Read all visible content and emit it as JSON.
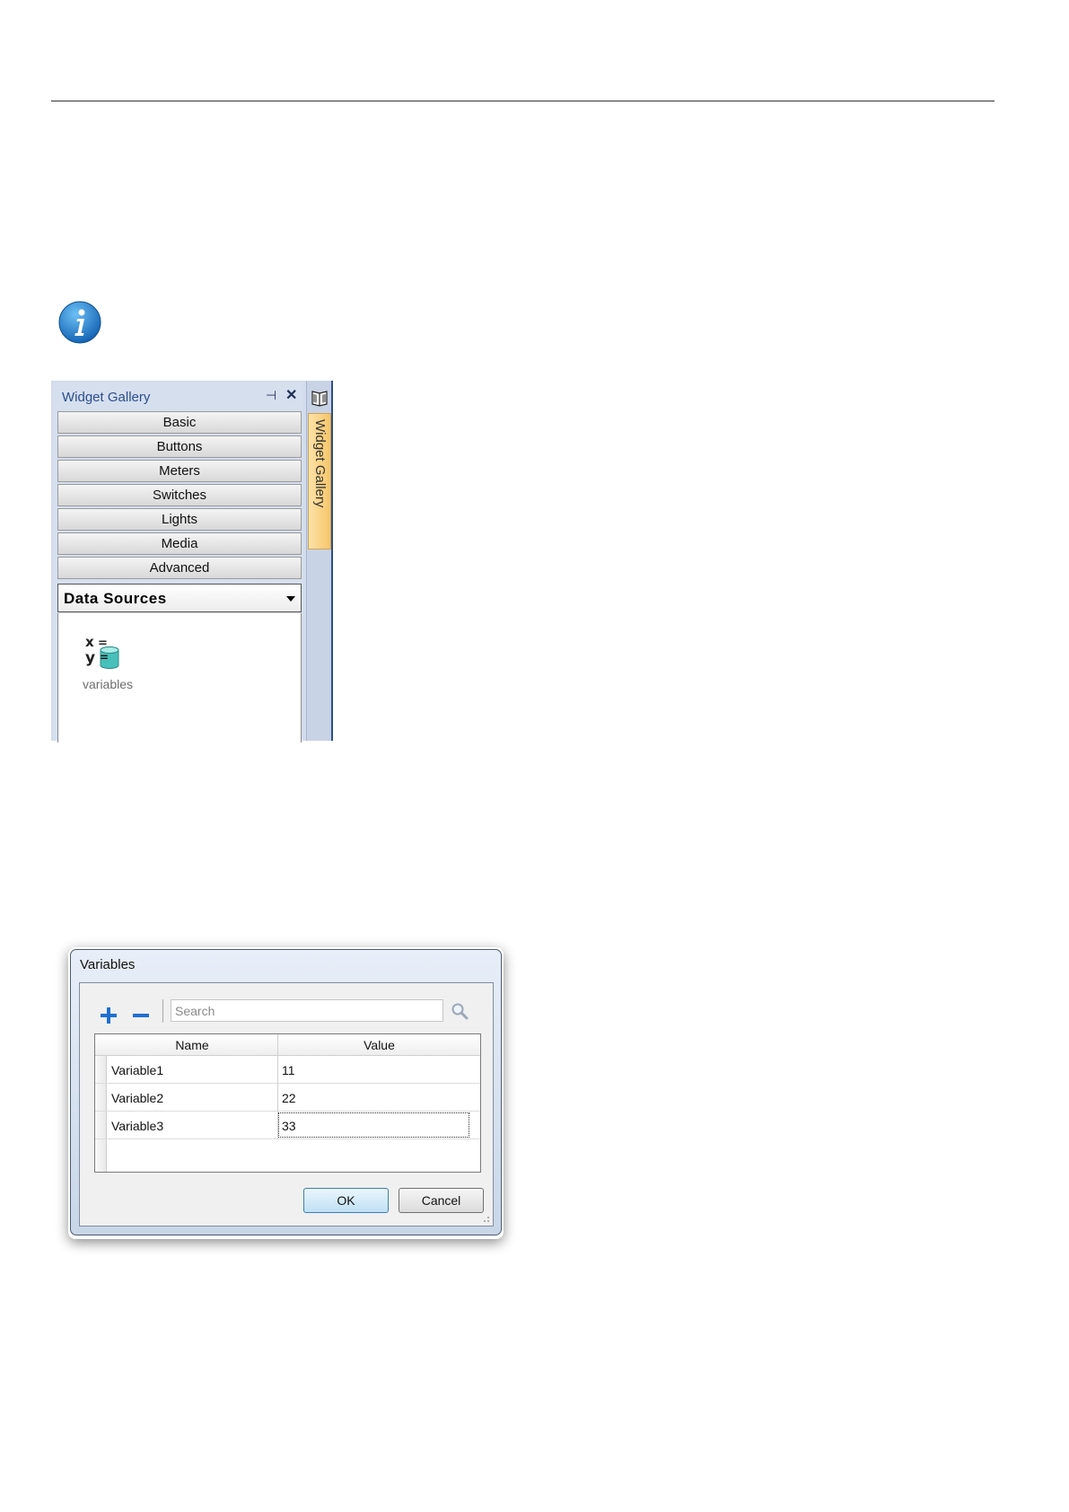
{
  "widget_gallery": {
    "title": "Widget Gallery",
    "side_tab_label": "Widget Gallery",
    "categories": [
      "Basic",
      "Buttons",
      "Meters",
      "Switches",
      "Lights",
      "Media",
      "Advanced"
    ],
    "active_category": "Data Sources",
    "items": [
      {
        "label": "variables",
        "icon": "variables-icon"
      }
    ]
  },
  "variables_dialog": {
    "title": "Variables",
    "search_placeholder": "Search",
    "columns": [
      "Name",
      "Value"
    ],
    "rows": [
      {
        "name": "Variable1",
        "value": "11"
      },
      {
        "name": "Variable2",
        "value": "22"
      },
      {
        "name": "Variable3",
        "value": "33"
      }
    ],
    "ok_label": "OK",
    "cancel_label": "Cancel"
  },
  "colors": {
    "panel_title": "#2c4d8f",
    "info_blue": "#1b7fd0",
    "add_remove_blue": "#1f6fd1"
  }
}
